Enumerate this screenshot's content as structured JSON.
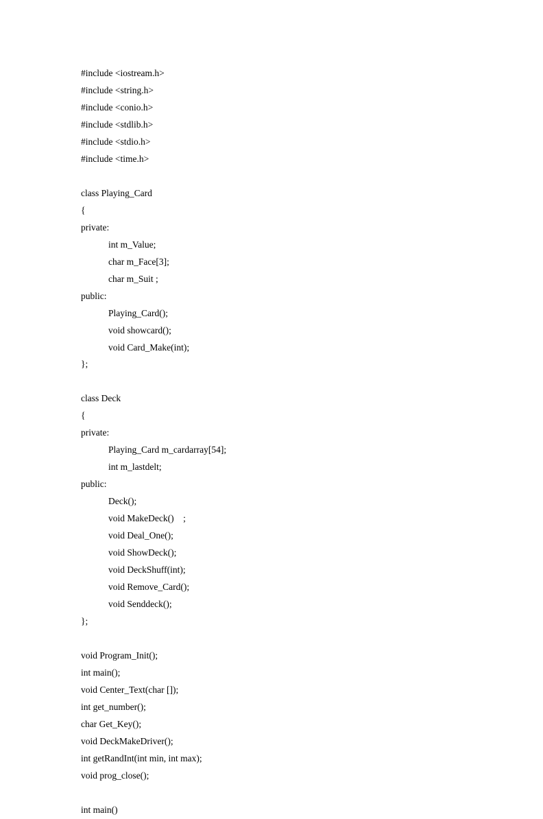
{
  "code": {
    "lines": [
      {
        "text": "#include <iostream.h>",
        "indent": false,
        "blank": false
      },
      {
        "text": "#include <string.h>",
        "indent": false,
        "blank": false
      },
      {
        "text": "#include <conio.h>",
        "indent": false,
        "blank": false
      },
      {
        "text": "#include <stdlib.h>",
        "indent": false,
        "blank": false
      },
      {
        "text": "#include <stdio.h>",
        "indent": false,
        "blank": false
      },
      {
        "text": "#include <time.h>",
        "indent": false,
        "blank": false
      },
      {
        "text": "",
        "indent": false,
        "blank": true
      },
      {
        "text": "class Playing_Card",
        "indent": false,
        "blank": false
      },
      {
        "text": "{",
        "indent": false,
        "blank": false
      },
      {
        "text": "private:",
        "indent": false,
        "blank": false
      },
      {
        "text": "int m_Value;",
        "indent": true,
        "blank": false
      },
      {
        "text": "char m_Face[3];",
        "indent": true,
        "blank": false
      },
      {
        "text": "char m_Suit ;",
        "indent": true,
        "blank": false
      },
      {
        "text": "public:",
        "indent": false,
        "blank": false
      },
      {
        "text": "Playing_Card();",
        "indent": true,
        "blank": false
      },
      {
        "text": "void showcard();",
        "indent": true,
        "blank": false
      },
      {
        "text": "void Card_Make(int);",
        "indent": true,
        "blank": false
      },
      {
        "text": "};",
        "indent": false,
        "blank": false
      },
      {
        "text": "",
        "indent": false,
        "blank": true
      },
      {
        "text": "class Deck",
        "indent": false,
        "blank": false
      },
      {
        "text": "{",
        "indent": false,
        "blank": false
      },
      {
        "text": "private:",
        "indent": false,
        "blank": false
      },
      {
        "text": "Playing_Card m_cardarray[54];",
        "indent": true,
        "blank": false
      },
      {
        "text": "int m_lastdelt;",
        "indent": true,
        "blank": false
      },
      {
        "text": "public:",
        "indent": false,
        "blank": false
      },
      {
        "text": "Deck();",
        "indent": true,
        "blank": false
      },
      {
        "text": "void MakeDeck()    ;",
        "indent": true,
        "blank": false
      },
      {
        "text": "void Deal_One();",
        "indent": true,
        "blank": false
      },
      {
        "text": "void ShowDeck();",
        "indent": true,
        "blank": false
      },
      {
        "text": "void DeckShuff(int);",
        "indent": true,
        "blank": false
      },
      {
        "text": "void Remove_Card();",
        "indent": true,
        "blank": false
      },
      {
        "text": "void Senddeck();",
        "indent": true,
        "blank": false
      },
      {
        "text": "};",
        "indent": false,
        "blank": false
      },
      {
        "text": "",
        "indent": false,
        "blank": true
      },
      {
        "text": "void Program_Init();",
        "indent": false,
        "blank": false
      },
      {
        "text": "int main();",
        "indent": false,
        "blank": false
      },
      {
        "text": "void Center_Text(char []);",
        "indent": false,
        "blank": false
      },
      {
        "text": "int get_number();",
        "indent": false,
        "blank": false
      },
      {
        "text": "char Get_Key();",
        "indent": false,
        "blank": false
      },
      {
        "text": "void DeckMakeDriver();",
        "indent": false,
        "blank": false
      },
      {
        "text": "int getRandInt(int min, int max);",
        "indent": false,
        "blank": false
      },
      {
        "text": "void prog_close();",
        "indent": false,
        "blank": false
      },
      {
        "text": "",
        "indent": false,
        "blank": true
      },
      {
        "text": "int main()",
        "indent": false,
        "blank": false
      }
    ]
  }
}
